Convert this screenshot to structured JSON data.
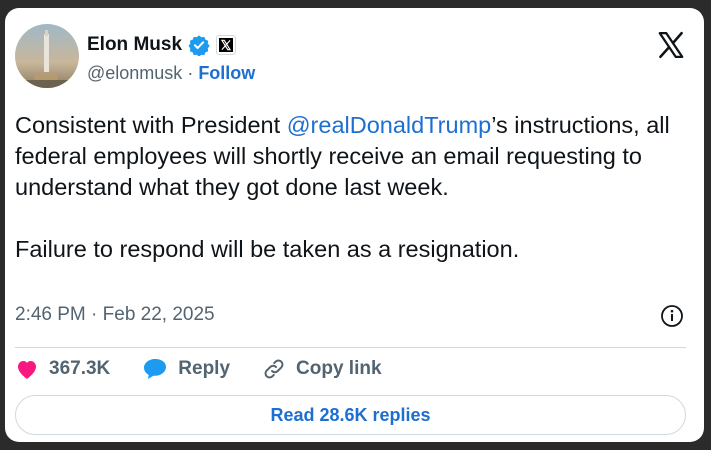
{
  "author": {
    "name": "Elon Musk",
    "handle": "@elonmusk",
    "separator": " · ",
    "follow_label": "Follow"
  },
  "tweet": {
    "text_before_mention": "Consistent with President ",
    "mention": "@realDonaldTrump",
    "text_after_mention": "’s instructions, all federal employees will shortly receive an email requesting to understand what they got done last week.",
    "second_paragraph": "Failure to respond will be taken as a resignation.",
    "timestamp": "2:46 PM · Feb 22, 2025"
  },
  "actions": {
    "likes": "367.3K",
    "reply_label": "Reply",
    "copy_link_label": "Copy link"
  },
  "read_replies_label": "Read 28.6K replies",
  "icons": {
    "heart": "heart-icon",
    "reply": "reply-bubble-icon",
    "copy_link": "link-icon",
    "info": "info-icon",
    "verified": "verified-badge-icon",
    "x_logo": "x-logo-icon"
  },
  "colors": {
    "link": "#1d6fd1",
    "like": "#f91880",
    "reply_bubble": "#1d9bf0",
    "verified": "#1d9bf0",
    "text": "#0f1419",
    "secondary": "#536471"
  }
}
